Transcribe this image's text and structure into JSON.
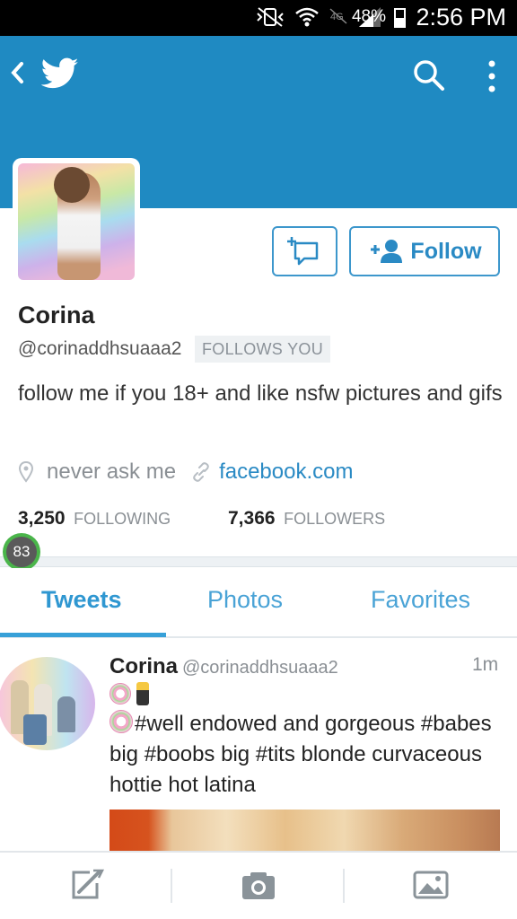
{
  "status_bar": {
    "battery_percent": "48%",
    "battery_level": 0.48,
    "time": "2:56 PM"
  },
  "header": {
    "back_icon": "chevron-left-icon",
    "logo_icon": "twitter-bird-icon",
    "search_icon": "search-icon",
    "more_icon": "more-vertical-icon",
    "background_color": "#1f8ac2"
  },
  "profile": {
    "name": "Corina",
    "handle": "@corinaddhsuaaa2",
    "follows_you": "FOLLOWS YOU",
    "bio": "follow me if you 18+ and like nsfw pictures and gifs",
    "location": "never ask me",
    "website": "facebook.com",
    "following_count": "3,250",
    "following_label": "FOLLOWING",
    "followers_count": "7,366",
    "followers_label": "FOLLOWERS",
    "follow_button": "Follow",
    "badge_count": "83"
  },
  "tabs": {
    "items": [
      "Tweets",
      "Photos",
      "Favorites"
    ],
    "active": "Tweets"
  },
  "tweet": {
    "name": "Corina",
    "handle": "@corinaddhsuaaa2",
    "time": "1m",
    "text": "#well endowed and gorgeous #babes big #boobs big #tits blonde curvaceous hottie hot latina"
  },
  "bottom_bar": {
    "icons": [
      "compose-icon",
      "camera-icon",
      "image-icon"
    ]
  },
  "colors": {
    "accent": "#2a8ac4",
    "tab_active": "#2f97d1",
    "badge_ring": "#4ab54a"
  }
}
